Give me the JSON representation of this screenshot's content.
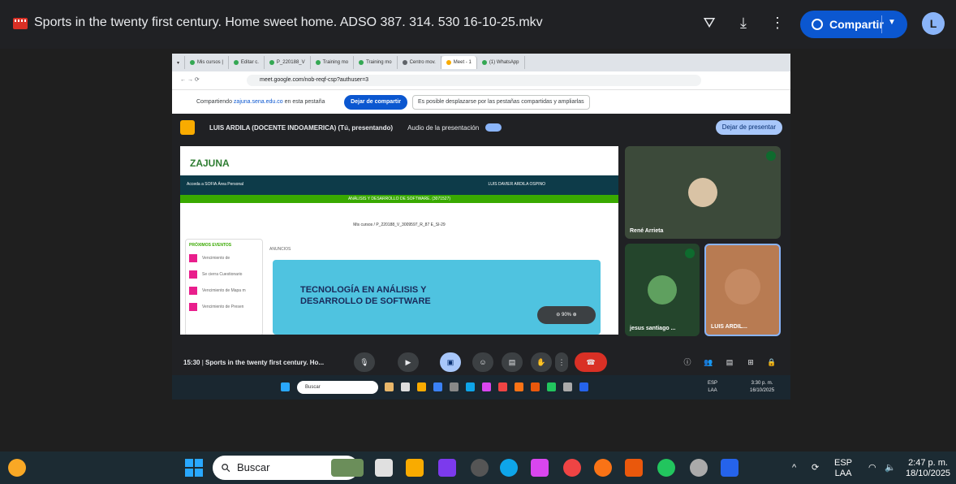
{
  "window": {
    "title": "Sports in the twenty first century. Home sweet home. ADSO 387. 314. 530 16-10-25.mkv",
    "share_label": "Compartir",
    "avatar_letter": "L"
  },
  "browser": {
    "tabs": [
      "Mis cursos |",
      "Editar c.",
      "P_220188_V",
      "Training mo",
      "Training mo",
      "Centro mov.",
      "Meet - 1",
      "(1) WhatsApp"
    ],
    "url": "meet.google.com/nob-reqf-csp?authuser=3",
    "share_text": "Compartiendo",
    "share_site": "zajuna.sena.edu.co",
    "share_suffix": "en esta pestaña",
    "stop_share": "Dejar de compartir",
    "info": "Es posible desplazarse por las pestañas compartidas y ampliarlas"
  },
  "meet": {
    "presenter": "LUIS ARDILA (DOCENTE INDOAMERICA) (Tú, presentando)",
    "audio_label": "Audio de la presentación",
    "stop_present": "Dejar de presentar",
    "slide": {
      "logo": "ZAJUNA",
      "nav_left": "Acceda a SOFIA    Área Personal",
      "nav_right": "LUIS DAVIER ARDILA OSPINO",
      "program": "ANÁLISIS Y DESARROLLO DE SOFTWARE. (3071527)",
      "breadcrumb": "Mis cursos  /  P_220188_V_3009597_R_87 E_SI-29",
      "events_title": "PRÓXIMOS EVENTOS",
      "events": [
        "Vencimiento de",
        "Se cierra Cuestionario",
        "Vencimiento de Mapa m",
        "Vencimiento de Presen"
      ],
      "section": "ANUNCIOS",
      "banner": "TECNOLOGÍA EN ANÁLISIS Y DESARROLLO DE SOFTWARE",
      "zoom": "90%"
    },
    "participants": [
      "René Arrieta",
      "jesus santiago ...",
      "LUIS ARDIL..."
    ],
    "time": "15:30",
    "meeting_title": "Sports in the twenty first century. Ho..."
  },
  "inner_taskbar": {
    "search": "Buscar",
    "lang": "ESP\nLAA",
    "clock": "3:30 p. m.\n16/10/2025"
  },
  "taskbar": {
    "search": "Buscar",
    "lang": "ESP\nLAA",
    "clock": "2:47 p. m.\n18/10/2025"
  }
}
